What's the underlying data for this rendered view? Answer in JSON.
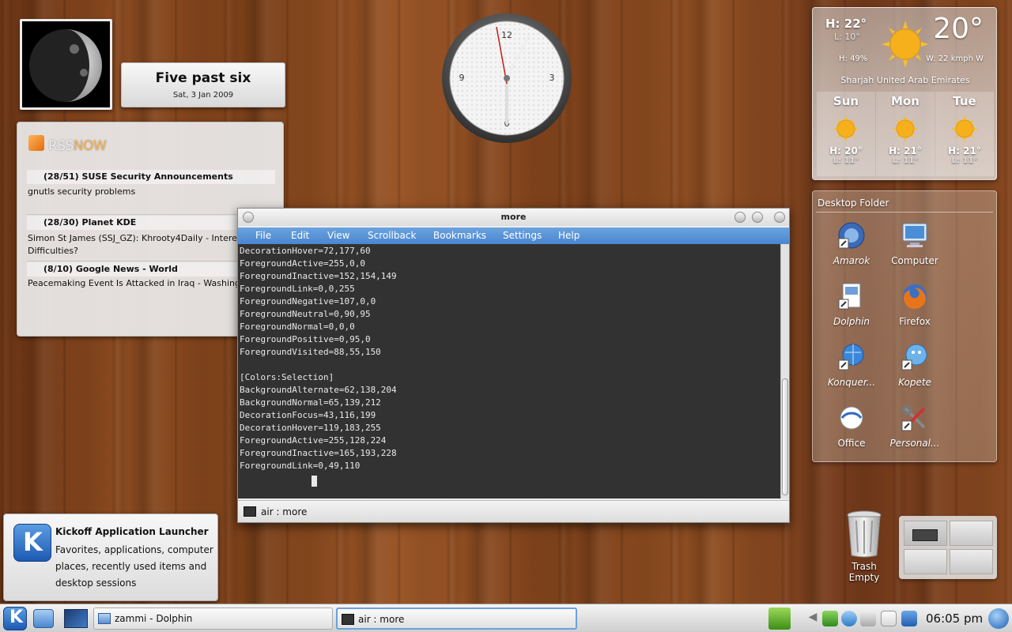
{
  "fuzzy_clock": {
    "time": "Five past six",
    "date": "Sat, 3 Jan 2009"
  },
  "analog_clock": {
    "numbers": [
      "12",
      "3",
      "6",
      "9"
    ]
  },
  "rss": {
    "logo_a": "RSS",
    "logo_b": "NOW",
    "feeds": [
      {
        "header": "(28/51) SUSE Security Announcements",
        "items": [
          "gnutls security problems"
        ]
      },
      {
        "header": "(28/30) Planet KDE",
        "items": [
          "Simon St James (SSJ_GZ): Khrooty4Daily - Interest? Po",
          "Difficulties?"
        ]
      },
      {
        "header": "(8/10) Google News - World",
        "items": [
          "Peacemaking Event Is Attacked in Iraq - Washington"
        ]
      }
    ]
  },
  "weather": {
    "high": "H: 22°",
    "low": "L: 10°",
    "humidity": "H: 49%",
    "temperature": "20°",
    "wind": "W: 22 kmph W",
    "location": "Sharjah  United Arab Emirates",
    "forecast": [
      {
        "day": "Sun",
        "high": "H: 20°",
        "low": "L: 11°"
      },
      {
        "day": "Mon",
        "high": "H: 21°",
        "low": "L: 11°"
      },
      {
        "day": "Tue",
        "high": "H: 21°",
        "low": "L: 11°"
      }
    ],
    "colors": {
      "sun": "#f5b01c"
    }
  },
  "desktop_folder": {
    "title": "Desktop Folder",
    "icons": [
      {
        "label": "Amarok",
        "icon": "amarok-icon"
      },
      {
        "label": "Computer",
        "icon": "computer-icon"
      },
      {
        "label": "Dolphin",
        "icon": "dolphin-icon"
      },
      {
        "label": "Firefox",
        "icon": "firefox-icon"
      },
      {
        "label": "Konquer...",
        "icon": "konqueror-icon"
      },
      {
        "label": "Kopete",
        "icon": "kopete-icon"
      },
      {
        "label": "Office",
        "icon": "office-icon"
      },
      {
        "label": "Personal...",
        "icon": "personal-icon"
      }
    ]
  },
  "konsole": {
    "title": "more",
    "menu": [
      "File",
      "Edit",
      "View",
      "Scrollback",
      "Bookmarks",
      "Settings",
      "Help"
    ],
    "lines": [
      "DecorationHover=72,177,60",
      "ForegroundActive=255,0,0",
      "ForegroundInactive=152,154,149",
      "ForegroundLink=0,0,255",
      "ForegroundNegative=107,0,0",
      "ForegroundNeutral=0,90,95",
      "ForegroundNormal=0,0,0",
      "ForegroundPositive=0,95,0",
      "ForegroundVisited=88,55,150",
      "",
      "[Colors:Selection]",
      "BackgroundAlternate=62,138,204",
      "BackgroundNormal=65,139,212",
      "DecorationFocus=43,116,199",
      "DecorationHover=119,183,255",
      "ForegroundActive=255,128,224",
      "ForegroundInactive=165,193,228",
      "ForegroundLink=0,49,110"
    ],
    "tab_label": "air : more",
    "colors": {
      "menubar": "#4a86cf",
      "terminal_bg": "#323232"
    }
  },
  "kickoff_tooltip": {
    "title": "Kickoff Application Launcher",
    "description": "Favorites, applications, computer places, recently used items and desktop sessions"
  },
  "trash": {
    "line1": "Trash",
    "line2": "Empty"
  },
  "taskbar": {
    "tasks": [
      {
        "label": "zammi - Dolphin",
        "active": false
      },
      {
        "label": "air : more",
        "active": true
      }
    ],
    "time": "06:05 pm"
  }
}
